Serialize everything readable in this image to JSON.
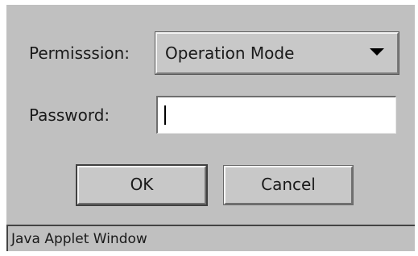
{
  "dialog": {
    "permission_label": "Permisssion:",
    "permission_value": "Operation Mode",
    "password_label": "Password:",
    "password_value": "",
    "ok_label": "OK",
    "cancel_label": "Cancel"
  },
  "status_bar": {
    "text": "Java Applet Window"
  },
  "icons": {
    "dropdown": "chevron-down-icon"
  },
  "colors": {
    "background": "#c0c0c0",
    "field": "#ffffff"
  }
}
